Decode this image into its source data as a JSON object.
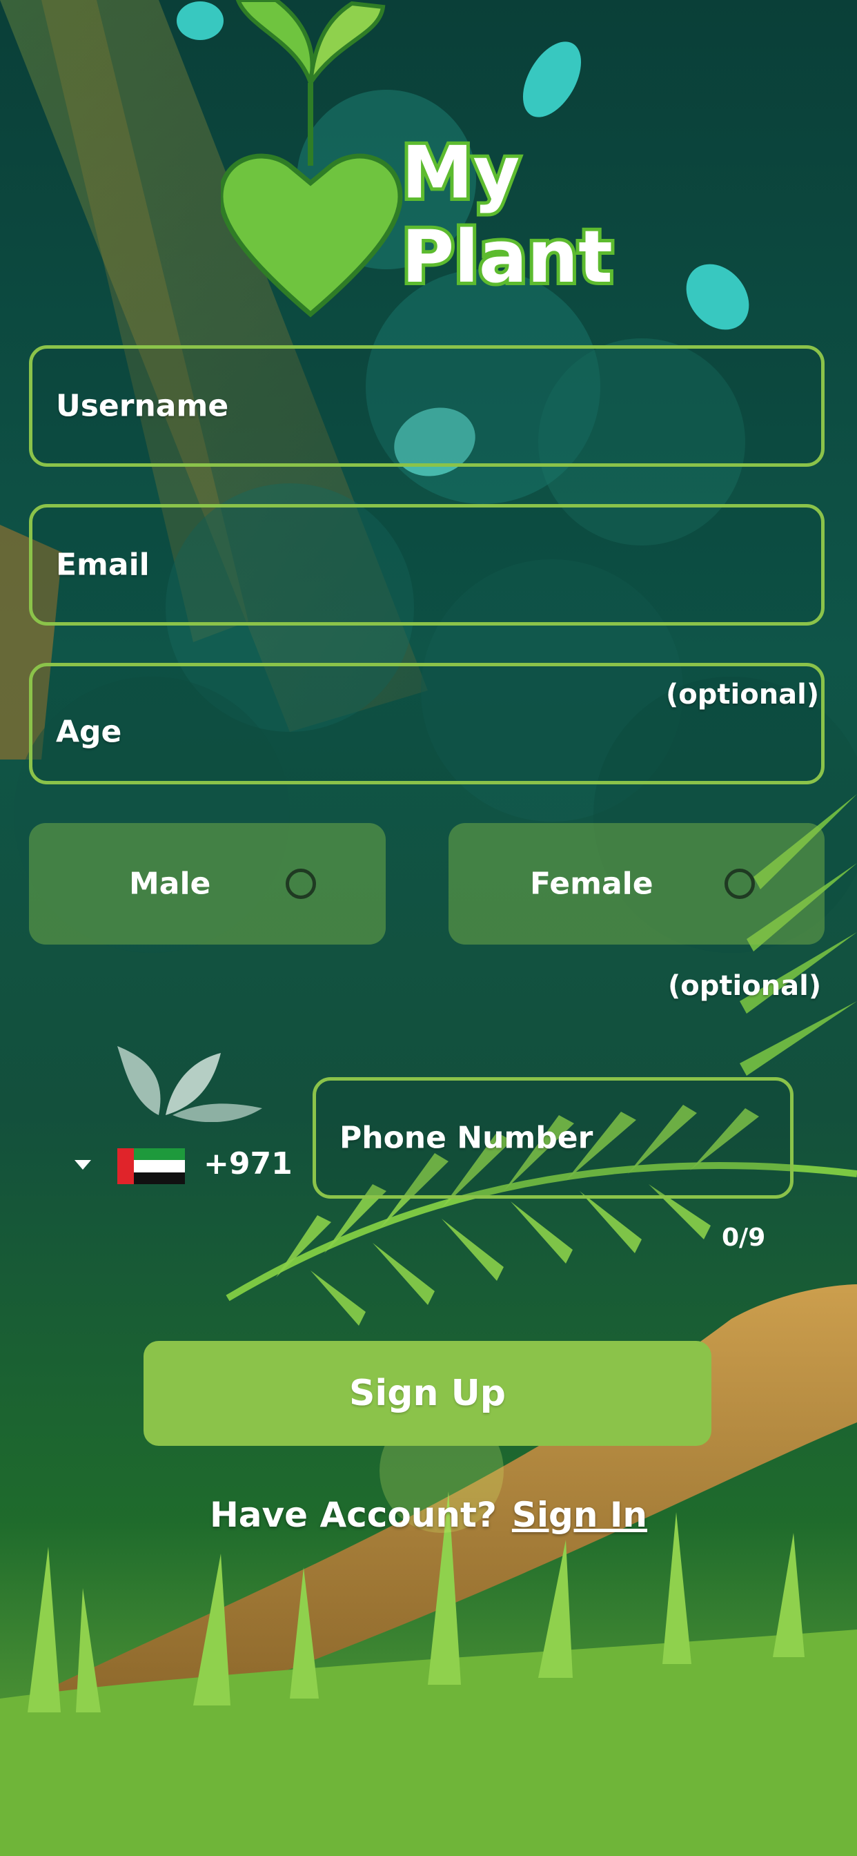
{
  "app": {
    "logo_line1": "My",
    "logo_line2": "Plant"
  },
  "form": {
    "username_placeholder": "Username",
    "email_placeholder": "Email",
    "age_placeholder": "Age",
    "age_optional": "(optional)",
    "gender_optional": "(optional)",
    "gender_options": [
      "Male",
      "Female"
    ],
    "country_code": "+971",
    "phone_placeholder": "Phone Number",
    "phone_counter": "0/9"
  },
  "actions": {
    "signup_label": "Sign Up",
    "have_account_text": "Have Account?",
    "signin_link": "Sign In"
  },
  "colors": {
    "accent": "#8bc34a",
    "background": "#0f4a3a"
  },
  "icons": {
    "country_dropdown": "caret-down-icon",
    "country_flag": "uae-flag-icon",
    "country_leaf": "leaf-icon"
  }
}
